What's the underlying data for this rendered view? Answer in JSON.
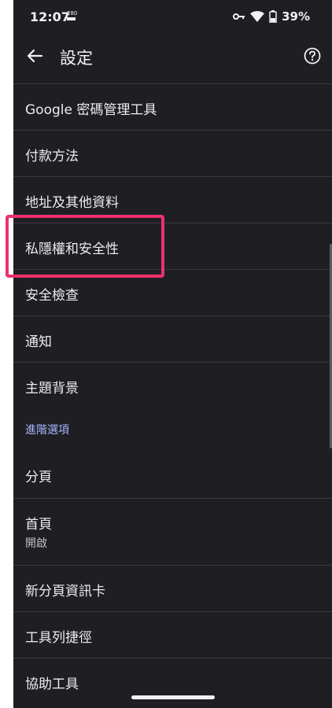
{
  "status_bar": {
    "time": "12:07",
    "badge_top": "280",
    "battery_percent": "39%",
    "icons": [
      "key-icon",
      "wifi-icon",
      "battery-icon"
    ]
  },
  "header": {
    "title": "設定",
    "back_icon": "arrow-left-icon",
    "help_icon": "help-circle-icon"
  },
  "settings_items": [
    {
      "label": "Google 密碼管理工具"
    },
    {
      "label": "付款方法"
    },
    {
      "label": "地址及其他資料"
    },
    {
      "label": "私隱權和安全性",
      "highlighted": true
    },
    {
      "label": "安全檢查"
    },
    {
      "label": "通知"
    },
    {
      "label": "主題背景"
    }
  ],
  "advanced_section": {
    "label": "進階選項",
    "items": [
      {
        "label": "分頁"
      },
      {
        "label": "首頁",
        "sublabel": "開啟"
      },
      {
        "label": "新分頁資訊卡"
      },
      {
        "label": "工具列捷徑"
      },
      {
        "label": "協助工具"
      }
    ]
  },
  "colors": {
    "background": "#1f1f23",
    "divider": "#3a3a3f",
    "section_accent": "#a9b6ff",
    "highlight_border": "#ee2f6c"
  }
}
